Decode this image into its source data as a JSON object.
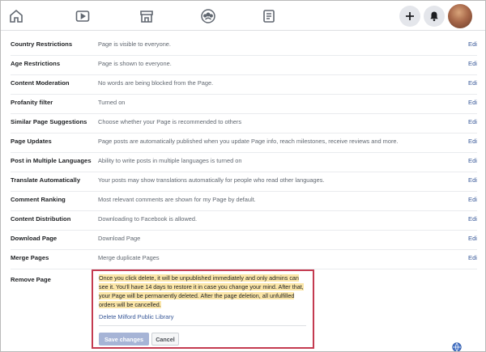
{
  "nav": {
    "icons": [
      "home-icon",
      "watch-icon",
      "marketplace-icon",
      "groups-icon",
      "pages-icon"
    ],
    "right_icons": [
      "plus-icon",
      "notifications-icon",
      "profile-avatar"
    ]
  },
  "settings": {
    "edit_label": "Edi",
    "rows": [
      {
        "label": "Country Restrictions",
        "value": "Page is visible to everyone."
      },
      {
        "label": "Age Restrictions",
        "value": "Page is shown to everyone."
      },
      {
        "label": "Content Moderation",
        "value": "No words are being blocked from the Page."
      },
      {
        "label": "Profanity filter",
        "value": "Turned on"
      },
      {
        "label": "Similar Page Suggestions",
        "value": "Choose whether your Page is recommended to others"
      },
      {
        "label": "Page Updates",
        "value": "Page posts are automatically published when you update Page info, reach milestones, receive reviews and more."
      },
      {
        "label": "Post in Multiple Languages",
        "value": "Ability to write posts in multiple languages is turned on"
      },
      {
        "label": "Translate Automatically",
        "value": "Your posts may show translations automatically for people who read other languages."
      },
      {
        "label": "Comment Ranking",
        "value": "Most relevant comments are shown for my Page by default."
      },
      {
        "label": "Content Distribution",
        "value": "Downloading to Facebook is allowed."
      },
      {
        "label": "Download Page",
        "value": "Download Page"
      },
      {
        "label": "Merge Pages",
        "value": "Merge duplicate Pages"
      }
    ]
  },
  "remove": {
    "label": "Remove Page",
    "warning": "Once you click delete, it will be unpublished immediately and only admins can see it. You'll have 14 days to restore it in case you change your mind. After that, your Page will be permanently deleted. After the page deletion, all unfulfilled orders will be cancelled.",
    "delete_link": "Delete Milford Public Library",
    "save_label": "Save changes",
    "cancel_label": "Cancel"
  },
  "colors": {
    "accent": "#385898",
    "highlight_border": "#c43b50",
    "text_highlight": "#fbe6a8",
    "save_disabled": "#a6b4d6"
  }
}
